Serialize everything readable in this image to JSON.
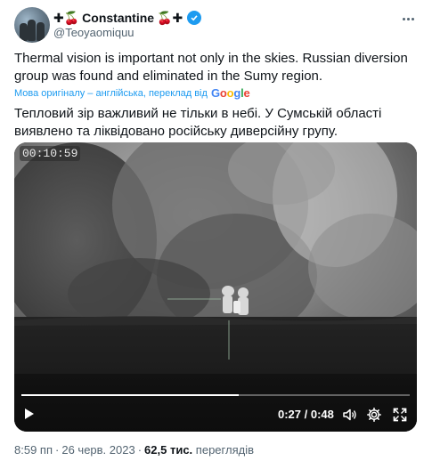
{
  "author": {
    "name": "Constantine",
    "handle": "@Teoyaomiquu",
    "verified": true,
    "name_emoji_left": "✚🍒",
    "name_emoji_right": "🍒✚"
  },
  "tweet": {
    "text": "Thermal vision is important not only in the skies. Russian diversion group was found and eliminated in the Sumy region.",
    "translation_note": "Мова оригіналу – англійська, переклад від",
    "translation_provider": "Google",
    "translated_text": "Тепловий зір важливий не тільки в небі. У Сумській області виявлено та ліквідовано російську диверсійну групу."
  },
  "video": {
    "overlay_timestamp": "00:10:59",
    "current_time": "0:27",
    "separator": " / ",
    "duration": "0:48",
    "progress_fraction": 0.56
  },
  "meta": {
    "time": "8:59 пп",
    "date": "26 черв. 2023",
    "views_count": "62,5 тис.",
    "views_label": "переглядів",
    "separator": "·"
  },
  "colors": {
    "accent": "#1d9bf0",
    "text": "#0f1419",
    "secondary_text": "#536471"
  },
  "icons": [
    "more-icon",
    "verified-icon",
    "play-icon",
    "volume-icon",
    "settings-icon",
    "fullscreen-icon"
  ]
}
